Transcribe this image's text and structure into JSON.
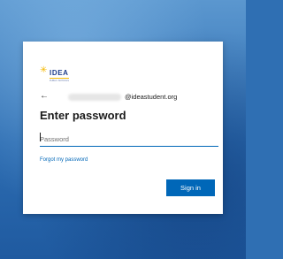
{
  "logo": {
    "text": "IDEA",
    "subtext": "PUBLIC SCHOOLS",
    "icon": "sunburst-logo"
  },
  "identity": {
    "back_icon": "arrow-left-icon",
    "email_domain": "@ideastudent.org"
  },
  "title": "Enter password",
  "password": {
    "placeholder": "Password",
    "value": ""
  },
  "forgot_link": "Forgot my password",
  "signin_button": "Sign in",
  "colors": {
    "accent": "#0067b8",
    "logo_blue": "#1f3e8c",
    "logo_yellow": "#f5b800"
  }
}
